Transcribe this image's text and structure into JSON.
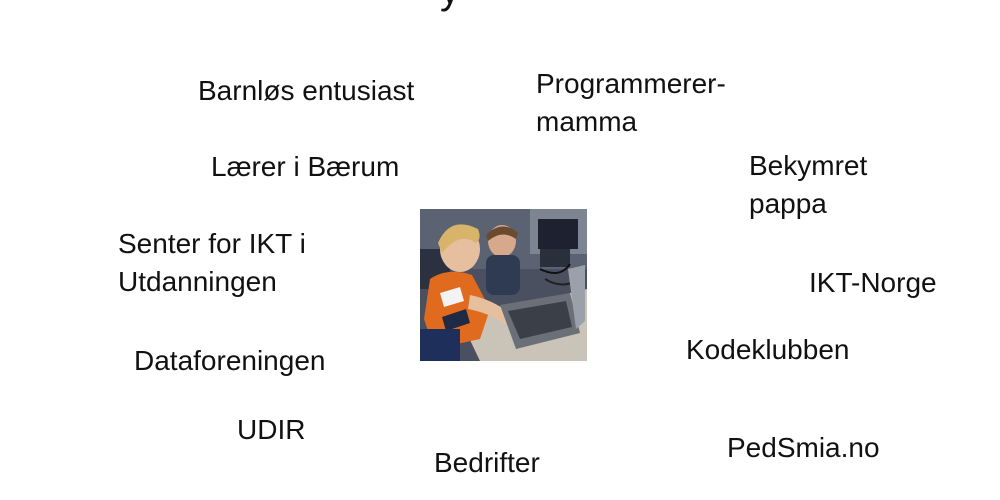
{
  "slide": {
    "title_fragment": "y",
    "labels": {
      "barnlos": "Barnløs entusiast",
      "programmerer_line1": "Programmerer-",
      "programmerer_line2": "mamma",
      "laerer": "Lærer i Bærum",
      "bekymret_line1": "Bekymret",
      "bekymret_line2": "pappa",
      "senter_line1": "Senter for IKT i",
      "senter_line2": "Utdanningen",
      "ikt_norge": "IKT-Norge",
      "kodeklubben": "Kodeklubben",
      "dataforeningen": "Dataforeningen",
      "udir": "UDIR",
      "pedsmia": "PedSmia.no",
      "bedrifter": "Bedrifter"
    },
    "photo": {
      "description_icon": "photo-icon"
    }
  }
}
